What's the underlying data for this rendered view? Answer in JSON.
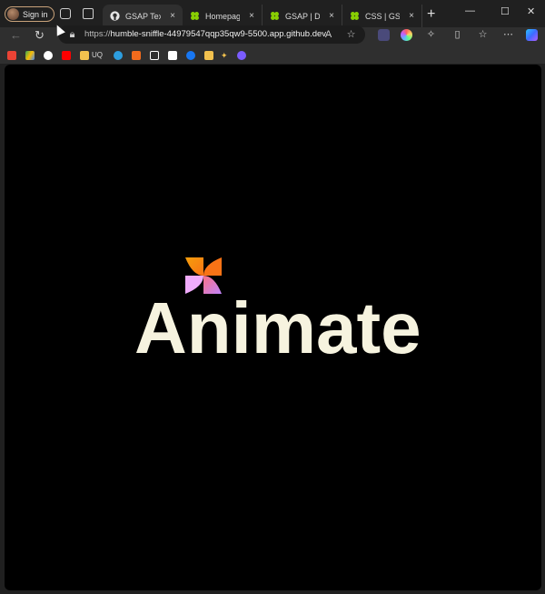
{
  "browser": {
    "signin_label": "Sign in",
    "tabs": [
      {
        "label": "GSAP Text",
        "favicon": "github-icon",
        "active": true
      },
      {
        "label": "Homepage | G",
        "favicon": "gsap-clover-icon",
        "active": false
      },
      {
        "label": "GSAP | Docs &",
        "favicon": "gsap-clover-icon",
        "active": false
      },
      {
        "label": "CSS | GSAP | D",
        "favicon": "gsap-clover-icon",
        "active": false
      }
    ],
    "close_glyph": "×",
    "new_tab_glyph": "+",
    "url_prefix": "https://",
    "url_host": "humble-sniffle-44979547qqp35qw9-5500.app.github.dev",
    "bookmarks": [
      {
        "label": "",
        "icon": "gmail-icon",
        "color": "#ea4335"
      },
      {
        "label": "",
        "icon": "drive-icon",
        "color": "#34a853"
      },
      {
        "label": "",
        "icon": "github-icon",
        "color": "#ffffff"
      },
      {
        "label": "",
        "icon": "youtube-icon",
        "color": "#ff0000"
      },
      {
        "label": "UQ",
        "icon": "folder-icon",
        "color": "#f2c14e"
      },
      {
        "label": "",
        "icon": "edge-icon",
        "color": "#2d9ee0"
      },
      {
        "label": "",
        "icon": "box-icon",
        "color": "#f26b1d"
      },
      {
        "label": "",
        "icon": "square-icon",
        "color": "#ffffff"
      },
      {
        "label": "",
        "icon": "notion-icon",
        "color": "#ffffff"
      },
      {
        "label": "",
        "icon": "facebook-icon",
        "color": "#1877f2"
      },
      {
        "label": "",
        "icon": "folder-icon",
        "color": "#f2c14e"
      },
      {
        "label": "",
        "icon": "star-icon",
        "color": "#f2c14e"
      },
      {
        "label": "",
        "icon": "app-icon",
        "color": "#7b5cff"
      }
    ]
  },
  "page": {
    "headline": "Animate",
    "headline_color": "#f6f3df",
    "logo_colors": [
      "#f59e0b",
      "#f97316",
      "#f0abfc",
      "#c084fc"
    ]
  }
}
